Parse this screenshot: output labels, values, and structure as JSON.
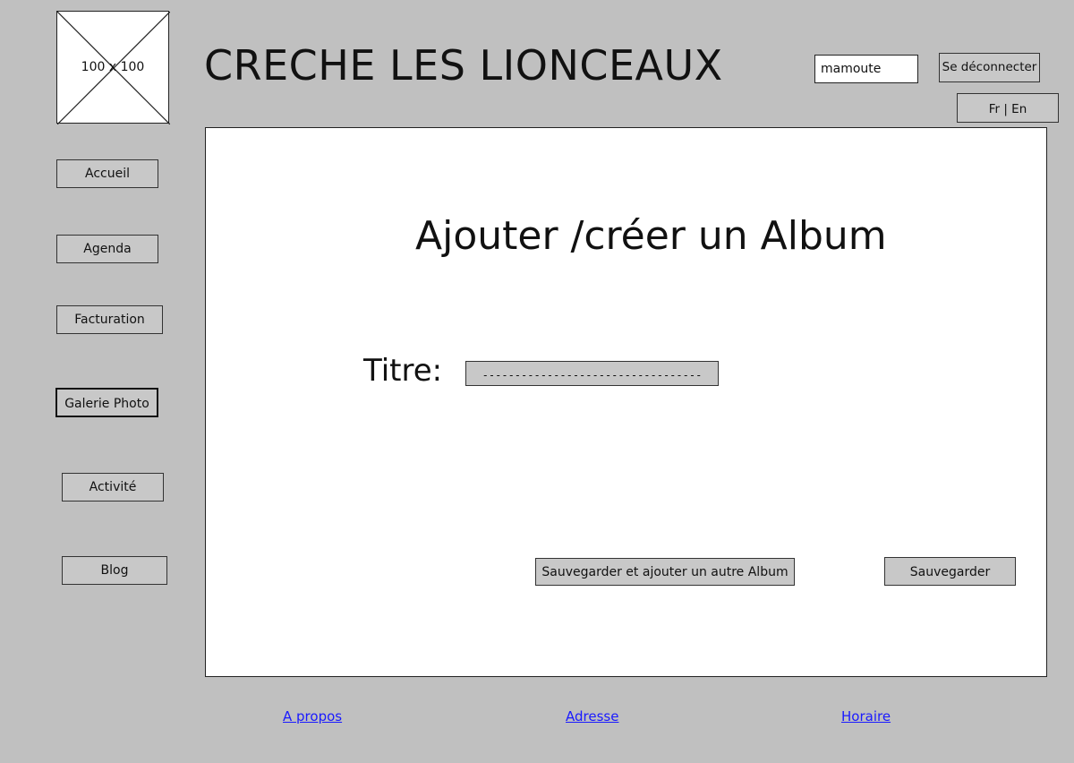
{
  "header": {
    "logo_placeholder": "100 x 100",
    "site_title": "CRECHE LES LIONCEAUX",
    "username": "mamoute",
    "logout_label": "Se déconnecter",
    "language_switch": "Fr | En"
  },
  "sidebar": {
    "items": [
      {
        "label": "Accueil"
      },
      {
        "label": "Agenda"
      },
      {
        "label": "Facturation"
      },
      {
        "label": "Galerie Photo"
      },
      {
        "label": "Activité"
      },
      {
        "label": "Blog"
      }
    ],
    "active_item": "Galerie Photo"
  },
  "main": {
    "heading": "Ajouter /créer un Album",
    "title_label": "Titre:",
    "title_input_value": "----------------------------------",
    "save_and_add_label": "Sauvegarder et ajouter un autre Album",
    "save_label": "Sauvegarder"
  },
  "footer": {
    "links": [
      {
        "label": "A propos"
      },
      {
        "label": "Adresse"
      },
      {
        "label": "Horaire"
      }
    ]
  },
  "colors": {
    "background": "#c0c0c0",
    "panel": "#ffffff",
    "button": "#c8c8c8",
    "link": "#1a1aff"
  }
}
